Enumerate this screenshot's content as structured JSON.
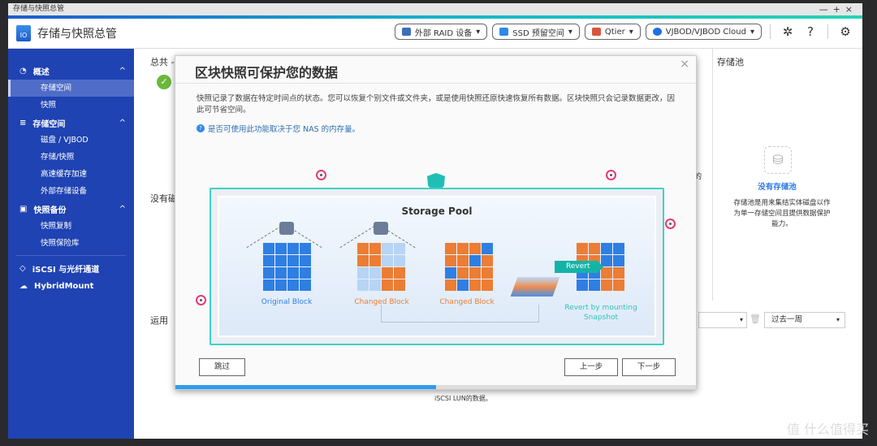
{
  "window": {
    "title": "存储与快照总管",
    "controls": [
      "—",
      "+",
      "×"
    ]
  },
  "header": {
    "app_title": "存储与快照总管",
    "tools": [
      {
        "label": "外部 RAID 设备",
        "icon": "raid-device-icon",
        "color": "#3a6fb8"
      },
      {
        "label": "SSD 预留空间",
        "icon": "ssd-icon",
        "color": "#2d8be5"
      },
      {
        "label": "Qtier",
        "icon": "qtier-icon",
        "color": "#d9543c"
      },
      {
        "label": "VJBOD/VJBOD Cloud",
        "icon": "vjbod-icon",
        "color": "#1e6fe0"
      }
    ]
  },
  "sidebar": {
    "groups": [
      {
        "label": "概述",
        "items": [
          "存储空间",
          "快照"
        ],
        "active": "存储空间"
      },
      {
        "label": "存储空间",
        "items": [
          "磁盘 / VJBOD",
          "存储/快照",
          "高速缓存加速",
          "外部存储设备"
        ]
      },
      {
        "label": "快照备份",
        "items": [
          "快照复制",
          "快照保险库"
        ]
      }
    ],
    "extra": [
      "iSCSI 与光纤通道",
      "HybridMount"
    ]
  },
  "main": {
    "total_label": "总共 -",
    "no_disk_label": "没有磁",
    "usage_label": "运用",
    "period_select": "过去一周",
    "partial_text": "的",
    "bottom_text": "iSCSI LUN的数据。"
  },
  "storage_pool_pane": {
    "title": "存储池",
    "empty_title": "没有存储池",
    "empty_desc": "存储池是用来集结实体磁盘以作为单一存储空间且提供数据保护能力。"
  },
  "dialog": {
    "title": "区块快照可保护您的数据",
    "close": "×",
    "description": "快照记录了数据在特定时间点的状态。您可以恢复个别文件或文件夹，或是使用快照还原快速恢复所有数据。区块快照只会记录数据更改，因此可节省空间。",
    "note": "是否可使用此功能取决于您 NAS 的内存量。",
    "diagram": {
      "title": "Storage Pool",
      "labels": [
        "Original Block",
        "Changed Block",
        "Changed Block",
        "Revert by mounting Snapshot"
      ],
      "revert": "Revert",
      "colors": {
        "blue": "#2f7fe3",
        "orange": "#ec7d35",
        "light": "#b7d4f5",
        "teal": "#2fc4b7"
      },
      "grids": [
        [
          "B",
          "B",
          "B",
          "B",
          "B",
          "B",
          "B",
          "B",
          "B",
          "B",
          "B",
          "B",
          "B",
          "B",
          "B",
          "B"
        ],
        [
          "O",
          "O",
          "L",
          "L",
          "O",
          "O",
          "L",
          "L",
          "L",
          "L",
          "O",
          "O",
          "L",
          "L",
          "O",
          "O"
        ],
        [
          "O",
          "O",
          "O",
          "B",
          "O",
          "O",
          "B",
          "O",
          "B",
          "O",
          "O",
          "O",
          "O",
          "B",
          "O",
          "O"
        ],
        [
          "O",
          "O",
          "B",
          "B",
          "O",
          "O",
          "B",
          "B",
          "B",
          "B",
          "O",
          "O",
          "B",
          "B",
          "O",
          "O"
        ]
      ]
    },
    "buttons": {
      "skip": "跳过",
      "prev": "上一步",
      "next": "下一步"
    },
    "progress_percent": 50
  },
  "watermark": "值 什么值得买"
}
